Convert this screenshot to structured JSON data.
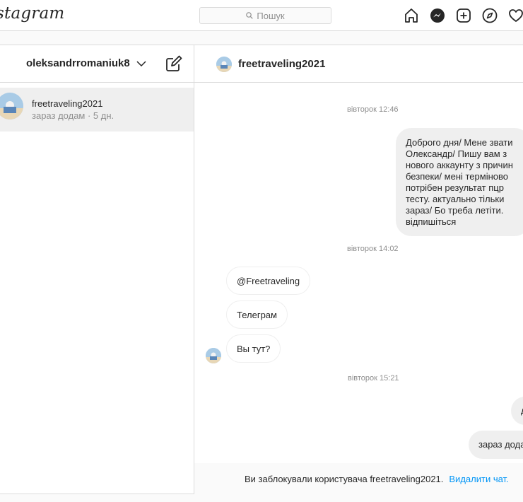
{
  "topbar": {
    "logo_text": "stagram",
    "search_placeholder": "Пошук",
    "icons": [
      "home-icon",
      "messenger-icon",
      "new-post-icon",
      "explore-icon",
      "activity-heart-icon"
    ]
  },
  "sidebar": {
    "account_name": "oleksandrromaniuk8",
    "conversations": [
      {
        "name": "freetraveling2021",
        "preview": "зараз додам · 5 дн."
      }
    ]
  },
  "chat": {
    "header_name": "freetraveling2021",
    "timestamps": [
      "вівторок 12:46",
      "вівторок 14:02",
      "вівторок 15:21"
    ],
    "outgoing_long": "Доброго дня/ Мене звати Олександр/ Пишу вам з нового аккаунту з причин безпеки/ мені терміново потрібен результат пцр тесту. актуально тільки зараз/ Бо треба летіти. відпишіться",
    "incoming": [
      "@Freetraveling",
      "Телеграм",
      "Вы тут?"
    ],
    "outgoing_short_1": "до",
    "outgoing_short_2": "зараз додам",
    "blocked_text": "Ви заблокували користувача freetraveling2021.",
    "blocked_link": "Видалити чат."
  },
  "colors": {
    "accent": "#0095f6",
    "border": "#dbdbdb",
    "bubble": "#efefef",
    "muted": "#8e8e8e"
  }
}
